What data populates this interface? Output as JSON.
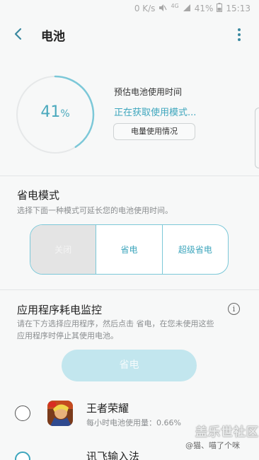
{
  "status": {
    "speed": "0 K/s",
    "network": "4G",
    "battery": "41%",
    "time": "15:13"
  },
  "header": {
    "title": "电池"
  },
  "battery": {
    "level": 41,
    "level_number": "41",
    "level_unit": "%",
    "estimate_label": "预估电池使用时间",
    "estimate_value": "正在获取使用模式...",
    "usage_button": "电量使用情况",
    "ring_color": "#7cc8d8"
  },
  "power_saving": {
    "title": "省电模式",
    "description": "选择下面一种模式可延长您的电池使用时间。",
    "modes": [
      {
        "label": "关闭",
        "selected": true
      },
      {
        "label": "省电",
        "selected": false
      },
      {
        "label": "超级省电",
        "selected": false
      }
    ]
  },
  "app_monitor": {
    "title": "应用程序耗电监控",
    "description_line1": "请在下方选择应用程序，然后点击 省电，在您未使用这些",
    "description_line2": "应用程序时停止其使用电池。",
    "save_button": "省电",
    "apps": [
      {
        "name": "王者荣耀",
        "usage": "每小时电池使用量：0.66%"
      },
      {
        "name": "讯飞输入法"
      }
    ]
  },
  "watermark": {
    "line1": "盖乐世社区",
    "line2": "@猫、喵了个咪"
  },
  "colors": {
    "accent": "#3ea6bd",
    "background": "#f7f8f8"
  }
}
